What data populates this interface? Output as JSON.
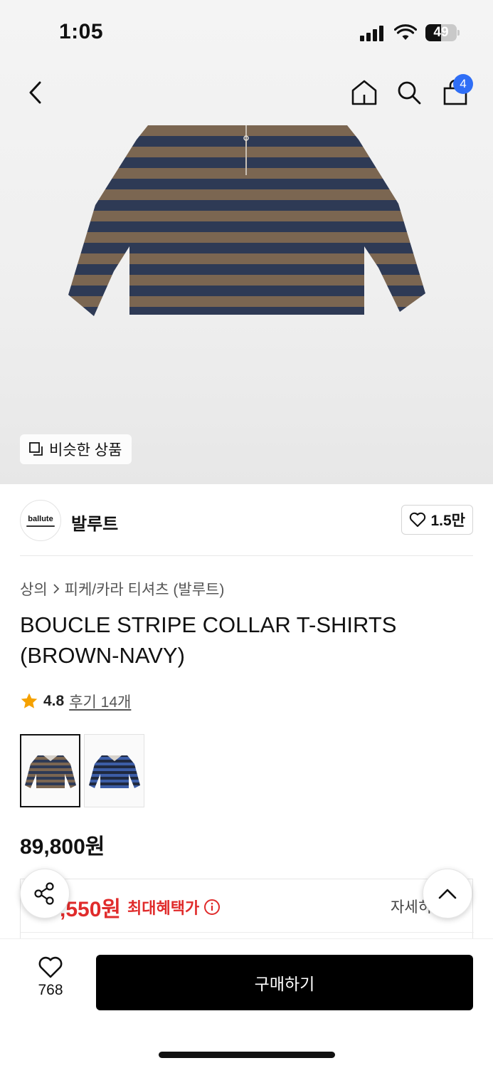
{
  "status_bar": {
    "time": "1:05",
    "battery": "49",
    "battery_level": 0.49
  },
  "nav": {
    "back_icon": "chevron-left-icon",
    "home_icon": "home-icon",
    "search_icon": "search-icon",
    "cart_icon": "shopping-bag-icon",
    "cart_count": "4"
  },
  "product_image": {
    "similar_label": "비슷한 상품"
  },
  "brand": {
    "logo_text": "ballute",
    "name": "발루트",
    "likes": "1.5만"
  },
  "breadcrumb": {
    "category": "상의",
    "subcategory": "피케/카라 티셔츠 (발루트)"
  },
  "product": {
    "title": "BOUCLE STRIPE COLLAR T-SHIRTS (BROWN-NAVY)",
    "rating": "4.8",
    "reviews": "후기 14개",
    "price": "89,800원"
  },
  "benefit": {
    "price_partial": ",550원",
    "label": "최대혜택가",
    "detail": "자세히"
  },
  "bottom": {
    "wish_count": "768",
    "buy_label": "구매하기"
  },
  "colors": {
    "accent_red": "#e02b2b",
    "badge_blue": "#2f6ef6",
    "stripe_brown": "#7b6651",
    "stripe_navy": "#2e3a55",
    "stripe_blue": "#3c5da6"
  }
}
